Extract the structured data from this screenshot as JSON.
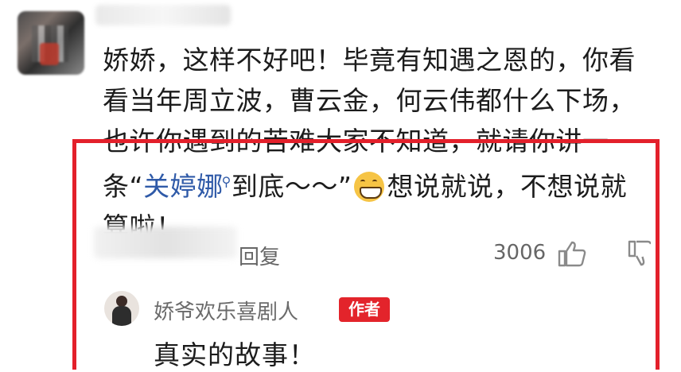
{
  "comment": {
    "author_name": "",
    "text_before_mention": "娇娇，这样不好吧！毕竟有知遇之恩的，你看看当年周立波，曹云金，何云伟都什么下场，也许你遇到的苦难大家不知道，就请你讲一条“",
    "mention": "关婷娜",
    "text_after_mention": "到底～～”",
    "text_after_emoji": "想说就说，不想说就算啦！",
    "emoji": "grinning-face"
  },
  "actions": {
    "reply_label": "回复",
    "like_count": "3006"
  },
  "reply": {
    "author": "娇爷欢乐喜剧人",
    "badge": "作者",
    "text": "真实的故事！"
  },
  "colors": {
    "highlight_border": "#e3202b",
    "mention": "#2f5aa8",
    "badge": "#e3242b"
  }
}
